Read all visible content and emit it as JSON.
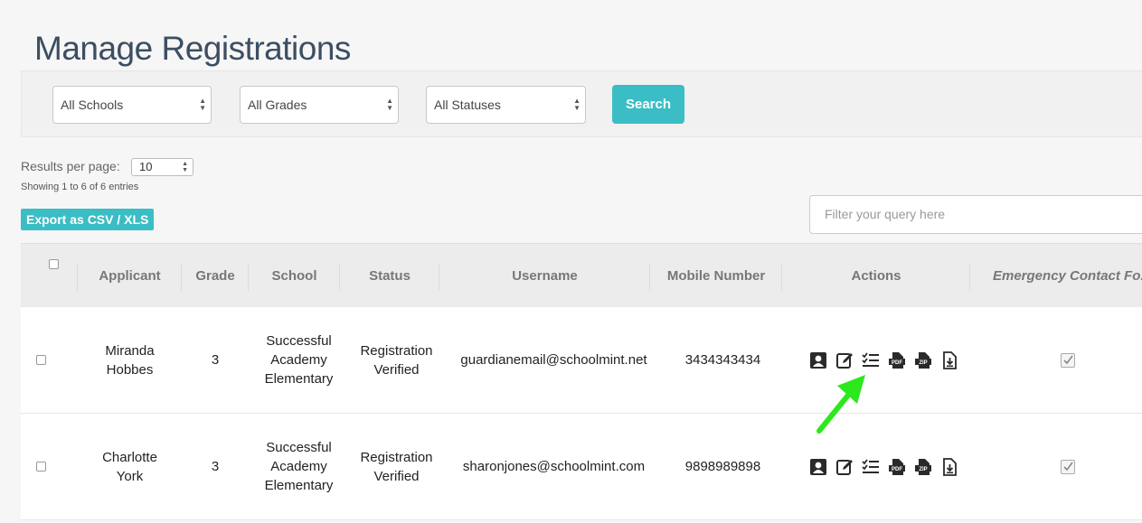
{
  "page": {
    "title": "Manage Registrations"
  },
  "filters": {
    "school": "All Schools",
    "grade": "All Grades",
    "status": "All Statuses",
    "search_label": "Search"
  },
  "results": {
    "per_page_label": "Results per page:",
    "per_page_value": "10",
    "showing_text": "Showing 1 to 6 of 6 entries",
    "export_label": "Export as CSV / XLS",
    "filter_placeholder": "Filter your query here"
  },
  "table": {
    "columns": [
      "Applicant",
      "Grade",
      "School",
      "Status",
      "Username",
      "Mobile Number",
      "Actions",
      "Emergency Contact Fo."
    ],
    "rows": [
      {
        "applicant": "Miranda\nHobbes",
        "grade": "3",
        "school": "Successful\nAcademy\nElementary",
        "status": "Registration\nVerified",
        "username": "guardianemail@schoolmint.net",
        "mobile": "3434343434",
        "emergency_checked": true
      },
      {
        "applicant": "Charlotte\nYork",
        "grade": "3",
        "school": "Successful\nAcademy\nElementary",
        "status": "Registration\nVerified",
        "username": "sharonjones@schoolmint.com",
        "mobile": "9898989898",
        "emergency_checked": true
      }
    ]
  },
  "action_icons": [
    "profile-icon",
    "edit-icon",
    "checklist-icon",
    "pdf-icon",
    "zip-icon",
    "download-icon"
  ],
  "colors": {
    "accent": "#3bbdc5",
    "title": "#3c4e62",
    "annotation_arrow": "#2de81c"
  }
}
